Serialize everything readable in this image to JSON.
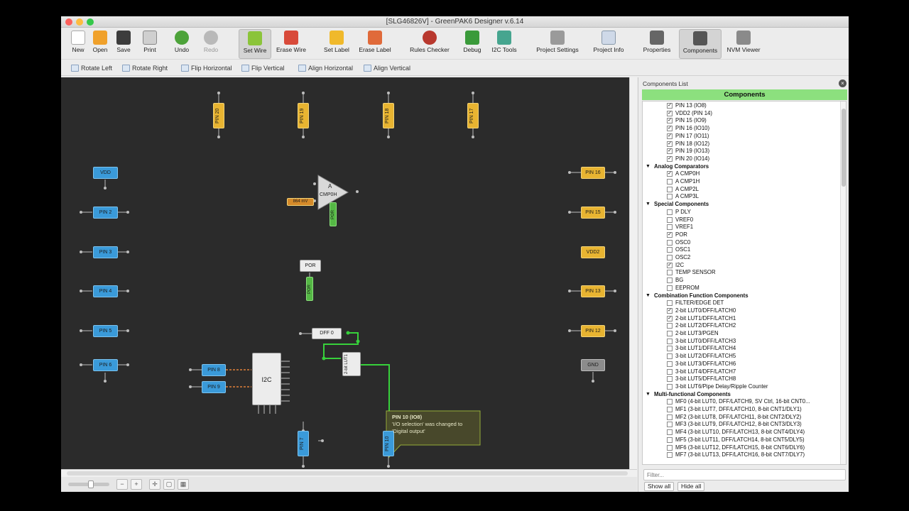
{
  "window": {
    "title": "[SLG46826V] - GreenPAK6 Designer v.6.14"
  },
  "colors": {
    "canvas_bg": "#2b2b2b",
    "pin_blue": "#3a9ad9",
    "pin_yellow": "#e8b431",
    "wire_green": "#37d13b",
    "panel_header": "#8ce07e"
  },
  "toolbar": {
    "new": "New",
    "open": "Open",
    "save": "Save",
    "print": "Print",
    "undo": "Undo",
    "redo": "Redo",
    "set_wire": "Set Wire",
    "erase_wire": "Erase Wire",
    "set_label": "Set Label",
    "erase_label": "Erase Label",
    "rules_checker": "Rules Checker",
    "debug": "Debug",
    "i2c_tools": "I2C Tools",
    "project_settings": "Project Settings",
    "project_info": "Project Info",
    "properties": "Properties",
    "components": "Components",
    "nvm_viewer": "NVM Viewer"
  },
  "toolbar2": {
    "rotate_left": "Rotate Left",
    "rotate_right": "Rotate Right",
    "flip_horizontal": "Flip Horizontal",
    "flip_vertical": "Flip Vertical",
    "align_horizontal": "Align Horizontal",
    "align_vertical": "Align Vertical"
  },
  "canvas": {
    "top_pins": [
      "PIN 20",
      "PIN 19",
      "PIN 18",
      "PIN 17"
    ],
    "left_pins": [
      "VDD",
      "PIN 2",
      "PIN 3",
      "PIN 4",
      "PIN 5",
      "PIN 6"
    ],
    "right_pins": [
      "PIN 16",
      "PIN 15",
      "VDD2",
      "PIN 13",
      "PIN 12",
      "GND"
    ],
    "i2c_pins": [
      "PIN 8",
      "PIN 9"
    ],
    "bottom_pins": [
      "PIN 7",
      "PIN 10"
    ],
    "acmp": {
      "letter": "A",
      "name": "CMP0H",
      "ref_label": "864 mV",
      "out_label": "POR"
    },
    "por_block": {
      "label": "POR",
      "out_label": "POR"
    },
    "dff_label": "DFF 0",
    "lut_label": "2-bit LUT1",
    "i2c_label": "I2C",
    "tooltip": {
      "title": "PIN 10 (IO8)",
      "line1": "'I/O selection' was changed to",
      "line2": "'Digital output'"
    }
  },
  "panel": {
    "title": "Components List",
    "header": "Components",
    "search_placeholder": "Filter...",
    "show_all": "Show all",
    "hide_all": "Hide all",
    "rows": [
      {
        "kind": "item",
        "label": "PIN 13 (IO8)",
        "checked": true
      },
      {
        "kind": "item",
        "label": "VDD2 (PIN 14)",
        "checked": true
      },
      {
        "kind": "item",
        "label": "PIN 15 (IO9)",
        "checked": true
      },
      {
        "kind": "item",
        "label": "PIN 16 (IO10)",
        "checked": true
      },
      {
        "kind": "item",
        "label": "PIN 17 (IO11)",
        "checked": true
      },
      {
        "kind": "item",
        "label": "PIN 18 (IO12)",
        "checked": true
      },
      {
        "kind": "item",
        "label": "PIN 19 (IO13)",
        "checked": true
      },
      {
        "kind": "item",
        "label": "PIN 20 (IO14)",
        "checked": true
      },
      {
        "kind": "cat",
        "label": "Analog Comparators"
      },
      {
        "kind": "item",
        "label": "A CMP0H",
        "checked": true
      },
      {
        "kind": "item",
        "label": "A CMP1H",
        "checked": false
      },
      {
        "kind": "item",
        "label": "A CMP2L",
        "checked": false
      },
      {
        "kind": "item",
        "label": "A CMP3L",
        "checked": false
      },
      {
        "kind": "cat",
        "label": "Special Components"
      },
      {
        "kind": "item",
        "label": "P DLY",
        "checked": false
      },
      {
        "kind": "item",
        "label": "VREF0",
        "checked": false
      },
      {
        "kind": "item",
        "label": "VREF1",
        "checked": false
      },
      {
        "kind": "item",
        "label": "POR",
        "checked": true
      },
      {
        "kind": "item",
        "label": "OSC0",
        "checked": false
      },
      {
        "kind": "item",
        "label": "OSC1",
        "checked": false
      },
      {
        "kind": "item",
        "label": "OSC2",
        "checked": false
      },
      {
        "kind": "item",
        "label": "I2C",
        "checked": true
      },
      {
        "kind": "item",
        "label": "TEMP SENSOR",
        "checked": false
      },
      {
        "kind": "item",
        "label": "BG",
        "checked": false
      },
      {
        "kind": "item",
        "label": "EEPROM",
        "checked": false
      },
      {
        "kind": "cat",
        "label": "Combination Function Components"
      },
      {
        "kind": "item",
        "label": "FILTER/EDGE DET",
        "checked": false
      },
      {
        "kind": "item",
        "label": "2-bit LUT0/DFF/LATCH0",
        "checked": true
      },
      {
        "kind": "item",
        "label": "2-bit LUT1/DFF/LATCH1",
        "checked": true
      },
      {
        "kind": "item",
        "label": "2-bit LUT2/DFF/LATCH2",
        "checked": false
      },
      {
        "kind": "item",
        "label": "2-bit LUT3/PGEN",
        "checked": false
      },
      {
        "kind": "item",
        "label": "3-bit LUT0/DFF/LATCH3",
        "checked": false
      },
      {
        "kind": "item",
        "label": "3-bit LUT1/DFF/LATCH4",
        "checked": false
      },
      {
        "kind": "item",
        "label": "3-bit LUT2/DFF/LATCH5",
        "checked": false
      },
      {
        "kind": "item",
        "label": "3-bit LUT3/DFF/LATCH6",
        "checked": false
      },
      {
        "kind": "item",
        "label": "3-bit LUT4/DFF/LATCH7",
        "checked": false
      },
      {
        "kind": "item",
        "label": "3-bit LUT5/DFF/LATCH8",
        "checked": false
      },
      {
        "kind": "item",
        "label": "3-bit LUT6/Pipe Delay/Ripple Counter",
        "checked": false
      },
      {
        "kind": "cat",
        "label": "Multi-functional Components"
      },
      {
        "kind": "item",
        "label": "MF0 (4-bit LUT0, DFF/LATCH9, SV Ctrl, 16-bit CNT0...",
        "checked": false
      },
      {
        "kind": "item",
        "label": "MF1 (3-bit LUT7, DFF/LATCH10, 8-bit CNT1/DLY1)",
        "checked": false
      },
      {
        "kind": "item",
        "label": "MF2 (3-bit LUT8, DFF/LATCH11, 8-bit CNT2/DLY2)",
        "checked": false
      },
      {
        "kind": "item",
        "label": "MF3 (3-bit LUT9, DFF/LATCH12, 8-bit CNT3/DLY3)",
        "checked": false
      },
      {
        "kind": "item",
        "label": "MF4 (3-bit LUT10, DFF/LATCH13, 8-bit CNT4/DLY4)",
        "checked": false
      },
      {
        "kind": "item",
        "label": "MF5 (3-bit LUT11, DFF/LATCH14, 8-bit CNT5/DLY5)",
        "checked": false
      },
      {
        "kind": "item",
        "label": "MF6 (3-bit LUT12, DFF/LATCH15, 8-bit CNT6/DLY6)",
        "checked": false
      },
      {
        "kind": "item",
        "label": "MF7 (3-bit LUT13, DFF/LATCH16, 8-bit CNT7/DLY7)",
        "checked": false
      }
    ]
  }
}
